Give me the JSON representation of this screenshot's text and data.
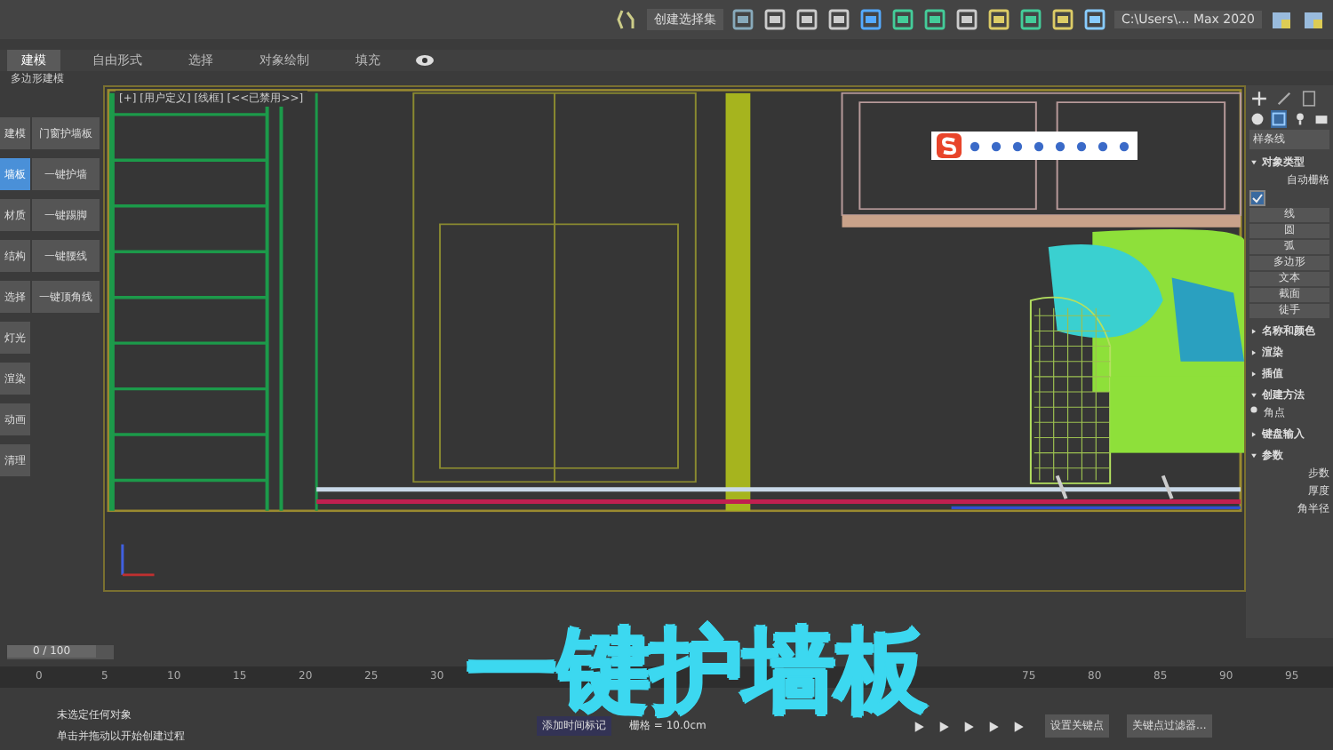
{
  "toolbar": {
    "selection_set": "创建选择集",
    "project_path": "C:\\Users\\... Max 2020"
  },
  "ribbon_tabs": [
    {
      "label": "建模",
      "selected": true
    },
    {
      "label": "自由形式",
      "selected": false
    },
    {
      "label": "选择",
      "selected": false
    },
    {
      "label": "对象绘制",
      "selected": false
    },
    {
      "label": "填充",
      "selected": false
    }
  ],
  "ribbon_subtitle": "多边形建模",
  "left_panel": {
    "categories": [
      {
        "label": "建模",
        "selected": false
      },
      {
        "label": "墙板",
        "selected": true
      },
      {
        "label": "材质",
        "selected": false
      },
      {
        "label": "结构",
        "selected": false
      },
      {
        "label": "选择",
        "selected": false
      },
      {
        "label": "灯光",
        "selected": false
      },
      {
        "label": "渲染",
        "selected": false
      },
      {
        "label": "动画",
        "selected": false
      },
      {
        "label": "清理",
        "selected": false
      }
    ],
    "tools": [
      "门窗护墙板",
      "一键护墙",
      "一键踢脚",
      "一键腰线",
      "一键顶角线"
    ]
  },
  "viewport": {
    "label": "[+] [用户定义] [线框] [<<已禁用>>]"
  },
  "command_panel": {
    "dropdown": "样条线",
    "object_type": {
      "title": "对象类型",
      "autogrid": "自动栅格",
      "start_new_shape": {
        "checked": true
      },
      "buttons": [
        "线",
        "圆",
        "弧",
        "多边形",
        "文本",
        "截面",
        "徒手"
      ]
    },
    "rollouts": [
      {
        "title": "名称和颜色",
        "expanded": false
      },
      {
        "title": "渲染",
        "expanded": false
      },
      {
        "title": "插值",
        "expanded": false
      },
      {
        "title": "创建方法",
        "expanded": true
      },
      {
        "title": "键盘输入",
        "expanded": false
      },
      {
        "title": "参数",
        "expanded": true
      }
    ],
    "creation_method": {
      "label": "角点",
      "selected": true
    },
    "parameters": [
      "步数",
      "厚度",
      "角半径"
    ]
  },
  "timeline": {
    "frame": "0 / 100",
    "level": 0.0,
    "ticks": [
      "0",
      "5",
      "10",
      "15",
      "20",
      "25",
      "30",
      "75",
      "80",
      "85",
      "90",
      "95"
    ]
  },
  "status": {
    "selection": "未选定任何对象",
    "prompt": "单击并拖动以开始创建过程",
    "time_tag": "添加时间标记",
    "grid": "栅格 = 10.0cm",
    "set_key": "设置关键点",
    "key_filters": "关键点过滤器..."
  },
  "caption": "一键护墙板"
}
